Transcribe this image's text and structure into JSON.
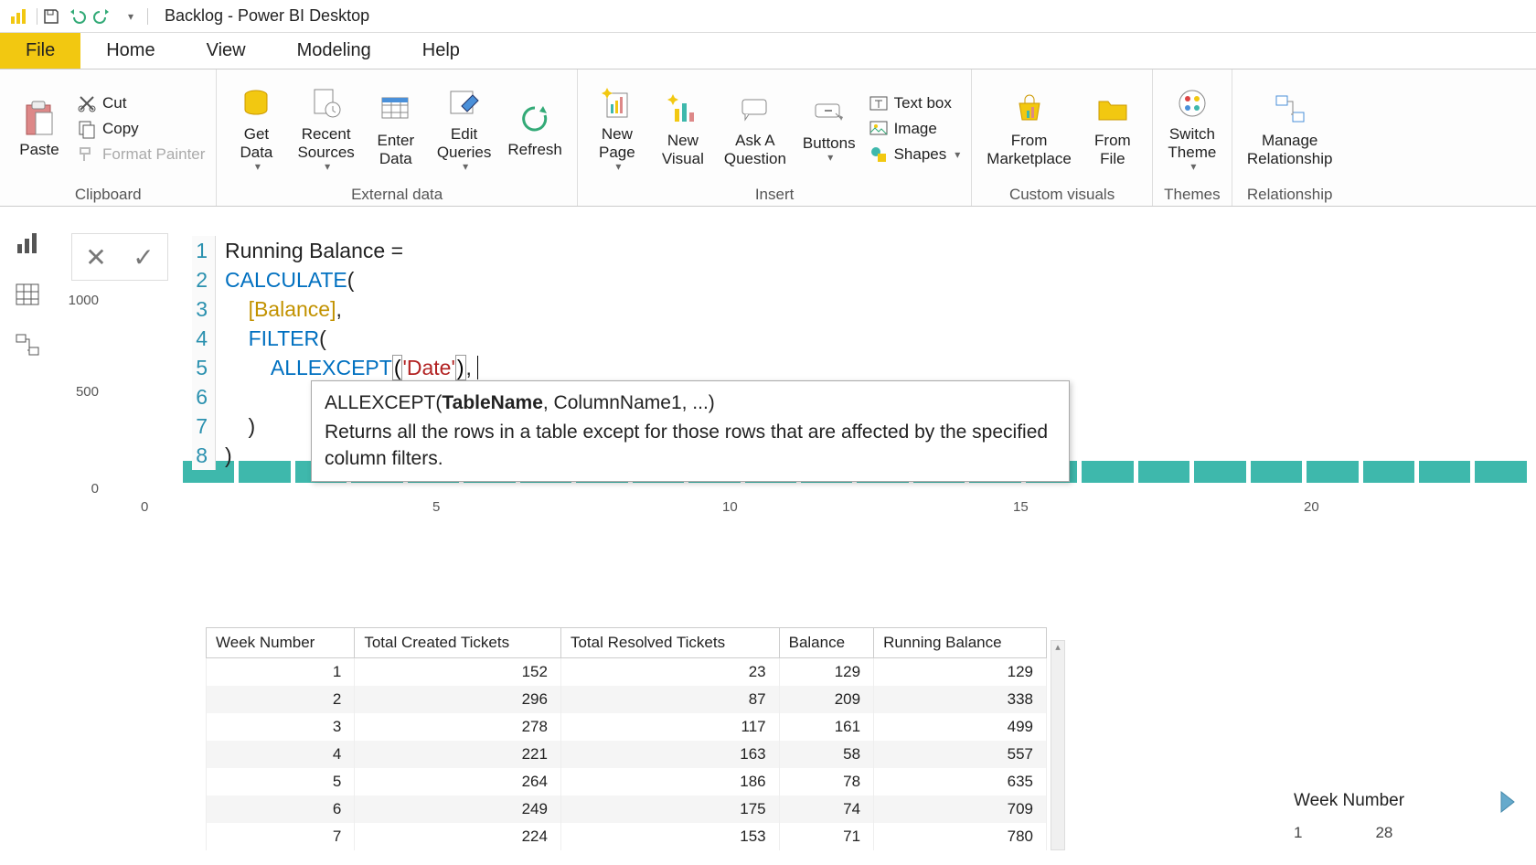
{
  "title_bar": {
    "title": "Backlog - Power BI Desktop"
  },
  "menu": {
    "file": "File",
    "home": "Home",
    "view": "View",
    "modeling": "Modeling",
    "help": "Help"
  },
  "ribbon": {
    "clipboard": {
      "paste": "Paste",
      "cut": "Cut",
      "copy": "Copy",
      "format_painter": "Format Painter",
      "label": "Clipboard"
    },
    "external": {
      "get_data": "Get\nData",
      "recent": "Recent\nSources",
      "enter": "Enter\nData",
      "edit": "Edit\nQueries",
      "refresh": "Refresh",
      "label": "External data"
    },
    "insert": {
      "new_page": "New\nPage",
      "new_visual": "New\nVisual",
      "ask": "Ask A\nQuestion",
      "buttons": "Buttons",
      "textbox": "Text box",
      "image": "Image",
      "shapes": "Shapes",
      "label": "Insert"
    },
    "custom": {
      "marketplace": "From\nMarketplace",
      "file": "From\nFile",
      "label": "Custom visuals"
    },
    "themes": {
      "switch": "Switch\nTheme",
      "label": "Themes"
    },
    "rel": {
      "manage": "Manage\nRelationship",
      "label": "Relationship"
    }
  },
  "formula": {
    "lines": [
      {
        "n": "1",
        "tokens": [
          {
            "t": "Running Balance = ",
            "c": "plain"
          }
        ]
      },
      {
        "n": "2",
        "tokens": [
          {
            "t": "CALCULATE",
            "c": "fn"
          },
          {
            "t": "(",
            "c": "plain"
          }
        ]
      },
      {
        "n": "3",
        "tokens": [
          {
            "t": "    ",
            "c": "plain"
          },
          {
            "t": "[Balance]",
            "c": "ref"
          },
          {
            "t": ",",
            "c": "plain"
          }
        ]
      },
      {
        "n": "4",
        "tokens": [
          {
            "t": "    ",
            "c": "plain"
          },
          {
            "t": "FILTER",
            "c": "fn"
          },
          {
            "t": "(",
            "c": "plain"
          }
        ]
      },
      {
        "n": "5",
        "tokens": [
          {
            "t": "        ",
            "c": "plain"
          },
          {
            "t": "ALLEXCEPT",
            "c": "fn"
          },
          {
            "t": "(",
            "c": "hl"
          },
          {
            "t": "'Date'",
            "c": "str"
          },
          {
            "t": ")",
            "c": "hl"
          },
          {
            "t": ",",
            "c": "plain"
          }
        ]
      },
      {
        "n": "6",
        "tokens": [
          {
            "t": " ",
            "c": "plain"
          }
        ]
      },
      {
        "n": "7",
        "tokens": [
          {
            "t": "    )",
            "c": "plain"
          }
        ]
      },
      {
        "n": "8",
        "tokens": [
          {
            "t": ")",
            "c": "plain"
          }
        ]
      }
    ]
  },
  "tooltip": {
    "fn": "ALLEXCEPT(",
    "bold": "TableName",
    "rest": ", ColumnName1, ...)",
    "desc": "Returns all the rows in a table except for those rows that are affected by the specified column filters."
  },
  "chart_data": {
    "type": "bar",
    "ylabel": "",
    "xlabel": "",
    "ylim": [
      0,
      1000
    ],
    "y_ticks": [
      0,
      500,
      1000
    ],
    "x_ticks": [
      0,
      5,
      10,
      15,
      20
    ],
    "categories": [
      1,
      2,
      3,
      4,
      5,
      6,
      7,
      8,
      9,
      10,
      11,
      12,
      13,
      14,
      15,
      16,
      17,
      18,
      19,
      20,
      21,
      22,
      23,
      24
    ],
    "values": [
      220,
      220,
      220,
      220,
      220,
      220,
      220,
      220,
      220,
      220,
      220,
      220,
      220,
      220,
      220,
      220,
      220,
      220,
      220,
      220,
      220,
      220,
      220,
      220
    ]
  },
  "table": {
    "headers": [
      "Week Number",
      "Total Created Tickets",
      "Total Resolved Tickets",
      "Balance",
      "Running Balance"
    ],
    "rows": [
      [
        1,
        152,
        23,
        129,
        129
      ],
      [
        2,
        296,
        87,
        209,
        338
      ],
      [
        3,
        278,
        117,
        161,
        499
      ],
      [
        4,
        221,
        163,
        58,
        557
      ],
      [
        5,
        264,
        186,
        78,
        635
      ],
      [
        6,
        249,
        175,
        74,
        709
      ],
      [
        7,
        224,
        153,
        71,
        780
      ]
    ]
  },
  "slicer": {
    "title": "Week Number",
    "min": "1",
    "max": "28"
  }
}
